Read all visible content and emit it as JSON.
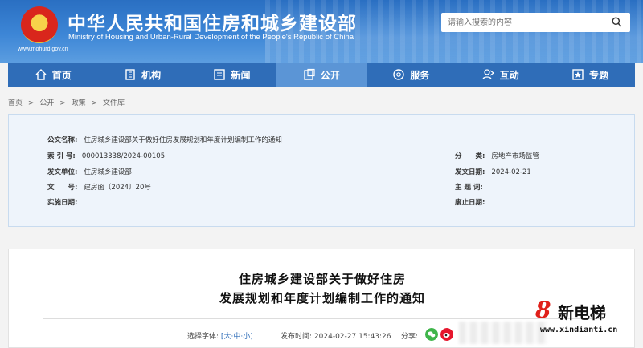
{
  "header": {
    "title": "中华人民共和国住房和城乡建设部",
    "subtitle": "Ministry of Housing and Urban-Rural Development of the People's Republic of China",
    "url": "www.mohurd.gov.cn",
    "search_placeholder": "请输入搜索的内容"
  },
  "nav": {
    "items": [
      {
        "label": "首页",
        "icon": "home-icon"
      },
      {
        "label": "机构",
        "icon": "building-icon"
      },
      {
        "label": "新闻",
        "icon": "news-icon"
      },
      {
        "label": "公开",
        "icon": "disclosure-icon",
        "active": true
      },
      {
        "label": "服务",
        "icon": "service-icon"
      },
      {
        "label": "互动",
        "icon": "interaction-icon"
      },
      {
        "label": "专题",
        "icon": "topic-icon"
      }
    ]
  },
  "breadcrumb": [
    "首页",
    ">",
    "公开",
    ">",
    "政策",
    ">",
    "文件库"
  ],
  "info": {
    "title_label": "公文名称:",
    "title_value": "住房城乡建设部关于做好住房发展规划和年度计划编制工作的通知",
    "index_label": "索 引 号:",
    "index_value": "000013338/2024-00105",
    "category_label": "分　　类:",
    "category_value": "房地产市场监管",
    "issuer_label": "发文单位:",
    "issuer_value": "住房城乡建设部",
    "date_label": "发文日期:",
    "date_value": "2024-02-21",
    "docno_label": "文　　号:",
    "docno_value": "建房函〔2024〕20号",
    "keywords_label": "主 题 词:",
    "keywords_value": "",
    "effective_label": "实施日期:",
    "effective_value": "",
    "expiry_label": "废止日期:",
    "expiry_value": ""
  },
  "article": {
    "title_line1": "住房城乡建设部关于做好住房",
    "title_line2": "发展规划和年度计划编制工作的通知",
    "font_select_label": "选择字体:",
    "font_bracket_open": "[",
    "font_large": "大",
    "font_medium": "中",
    "font_small": "小",
    "font_bracket_close": "]",
    "font_sep": "·",
    "publish_label": "发布时间:",
    "publish_time": "2024-02-27 15:43:26",
    "share_label": "分享:"
  },
  "watermark": {
    "logo": "8",
    "text": "新电梯",
    "url": "www.xindianti.cn"
  },
  "colors": {
    "header_blue": "#2a6fc2",
    "nav_blue": "#2f6db8",
    "nav_active": "#5b95d6",
    "info_bg": "#eef4fb",
    "wechat_green": "#3fb54a",
    "weibo_red": "#e6162d"
  }
}
